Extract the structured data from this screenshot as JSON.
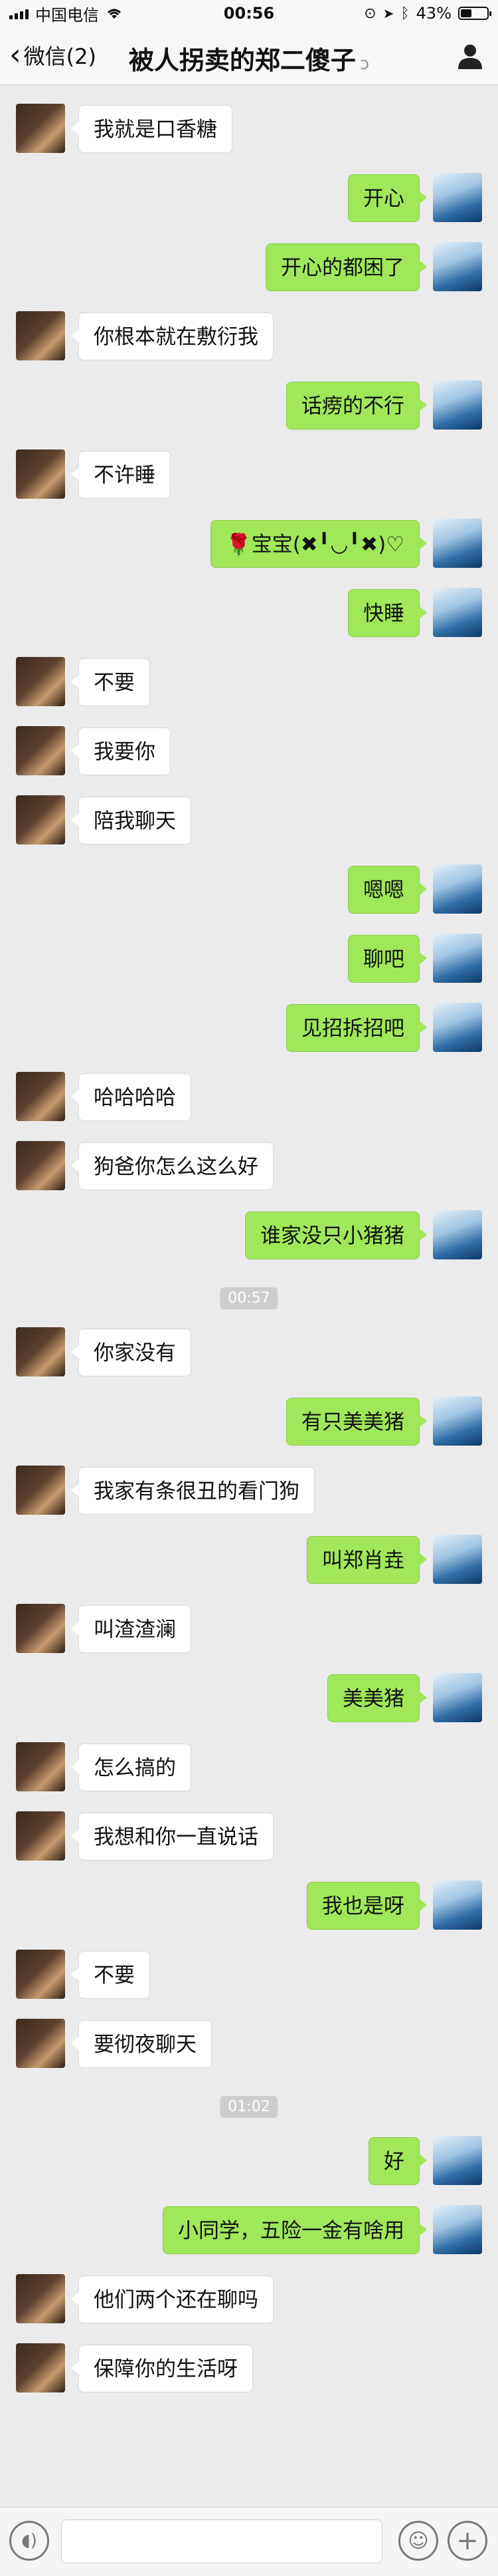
{
  "status_bar": {
    "carrier": "中国电信",
    "time": "00:56",
    "battery": "43%",
    "battery_level": 0.43
  },
  "nav": {
    "back_label": "微信(2)",
    "title": "被人拐卖的郑二傻子",
    "mute_icon": "ear-mute-icon",
    "profile_icon": "person-icon"
  },
  "messages": [
    {
      "side": "left",
      "text": "我就是口香糖"
    },
    {
      "side": "right",
      "text": "开心"
    },
    {
      "side": "right",
      "text": "开心的都困了"
    },
    {
      "side": "left",
      "text": "你根本就在敷衍我"
    },
    {
      "side": "right",
      "text": "话痨的不行"
    },
    {
      "side": "left",
      "text": "不许睡"
    },
    {
      "side": "right",
      "text": "🌹宝宝(✖╹◡╹✖)♡"
    },
    {
      "side": "right",
      "text": "快睡"
    },
    {
      "side": "left",
      "text": "不要"
    },
    {
      "side": "left",
      "text": "我要你"
    },
    {
      "side": "left",
      "text": "陪我聊天"
    },
    {
      "side": "right",
      "text": "嗯嗯"
    },
    {
      "side": "right",
      "text": "聊吧"
    },
    {
      "side": "right",
      "text": "见招拆招吧"
    },
    {
      "side": "left",
      "text": "哈哈哈哈"
    },
    {
      "side": "left",
      "text": "狗爸你怎么这么好"
    },
    {
      "side": "right",
      "text": "谁家没只小猪猪"
    },
    {
      "side": "time",
      "text": "00:57"
    },
    {
      "side": "left",
      "text": "你家没有"
    },
    {
      "side": "right",
      "text": "有只美美猪"
    },
    {
      "side": "left",
      "text": "我家有条很丑的看门狗"
    },
    {
      "side": "right",
      "text": "叫郑肖垚"
    },
    {
      "side": "left",
      "text": "叫渣渣澜"
    },
    {
      "side": "right",
      "text": "美美猪"
    },
    {
      "side": "left",
      "text": "怎么搞的"
    },
    {
      "side": "left",
      "text": "我想和你一直说话"
    },
    {
      "side": "right",
      "text": "我也是呀"
    },
    {
      "side": "left",
      "text": "不要"
    },
    {
      "side": "left",
      "text": "要彻夜聊天"
    },
    {
      "side": "time",
      "text": "01:02"
    },
    {
      "side": "right",
      "text": "好"
    },
    {
      "side": "right",
      "text": "小同学，五险一金有啥用"
    },
    {
      "side": "left",
      "text": "他们两个还在聊吗"
    },
    {
      "side": "left",
      "text": "保障你的生活呀"
    }
  ],
  "input_bar": {
    "voice_icon": "voice-icon",
    "emoji_icon": "emoji-icon",
    "plus_icon": "plus-icon",
    "input_value": ""
  },
  "colors": {
    "background": "#ebebeb",
    "self_bubble": "#a0e75a",
    "other_bubble": "#ffffff"
  }
}
